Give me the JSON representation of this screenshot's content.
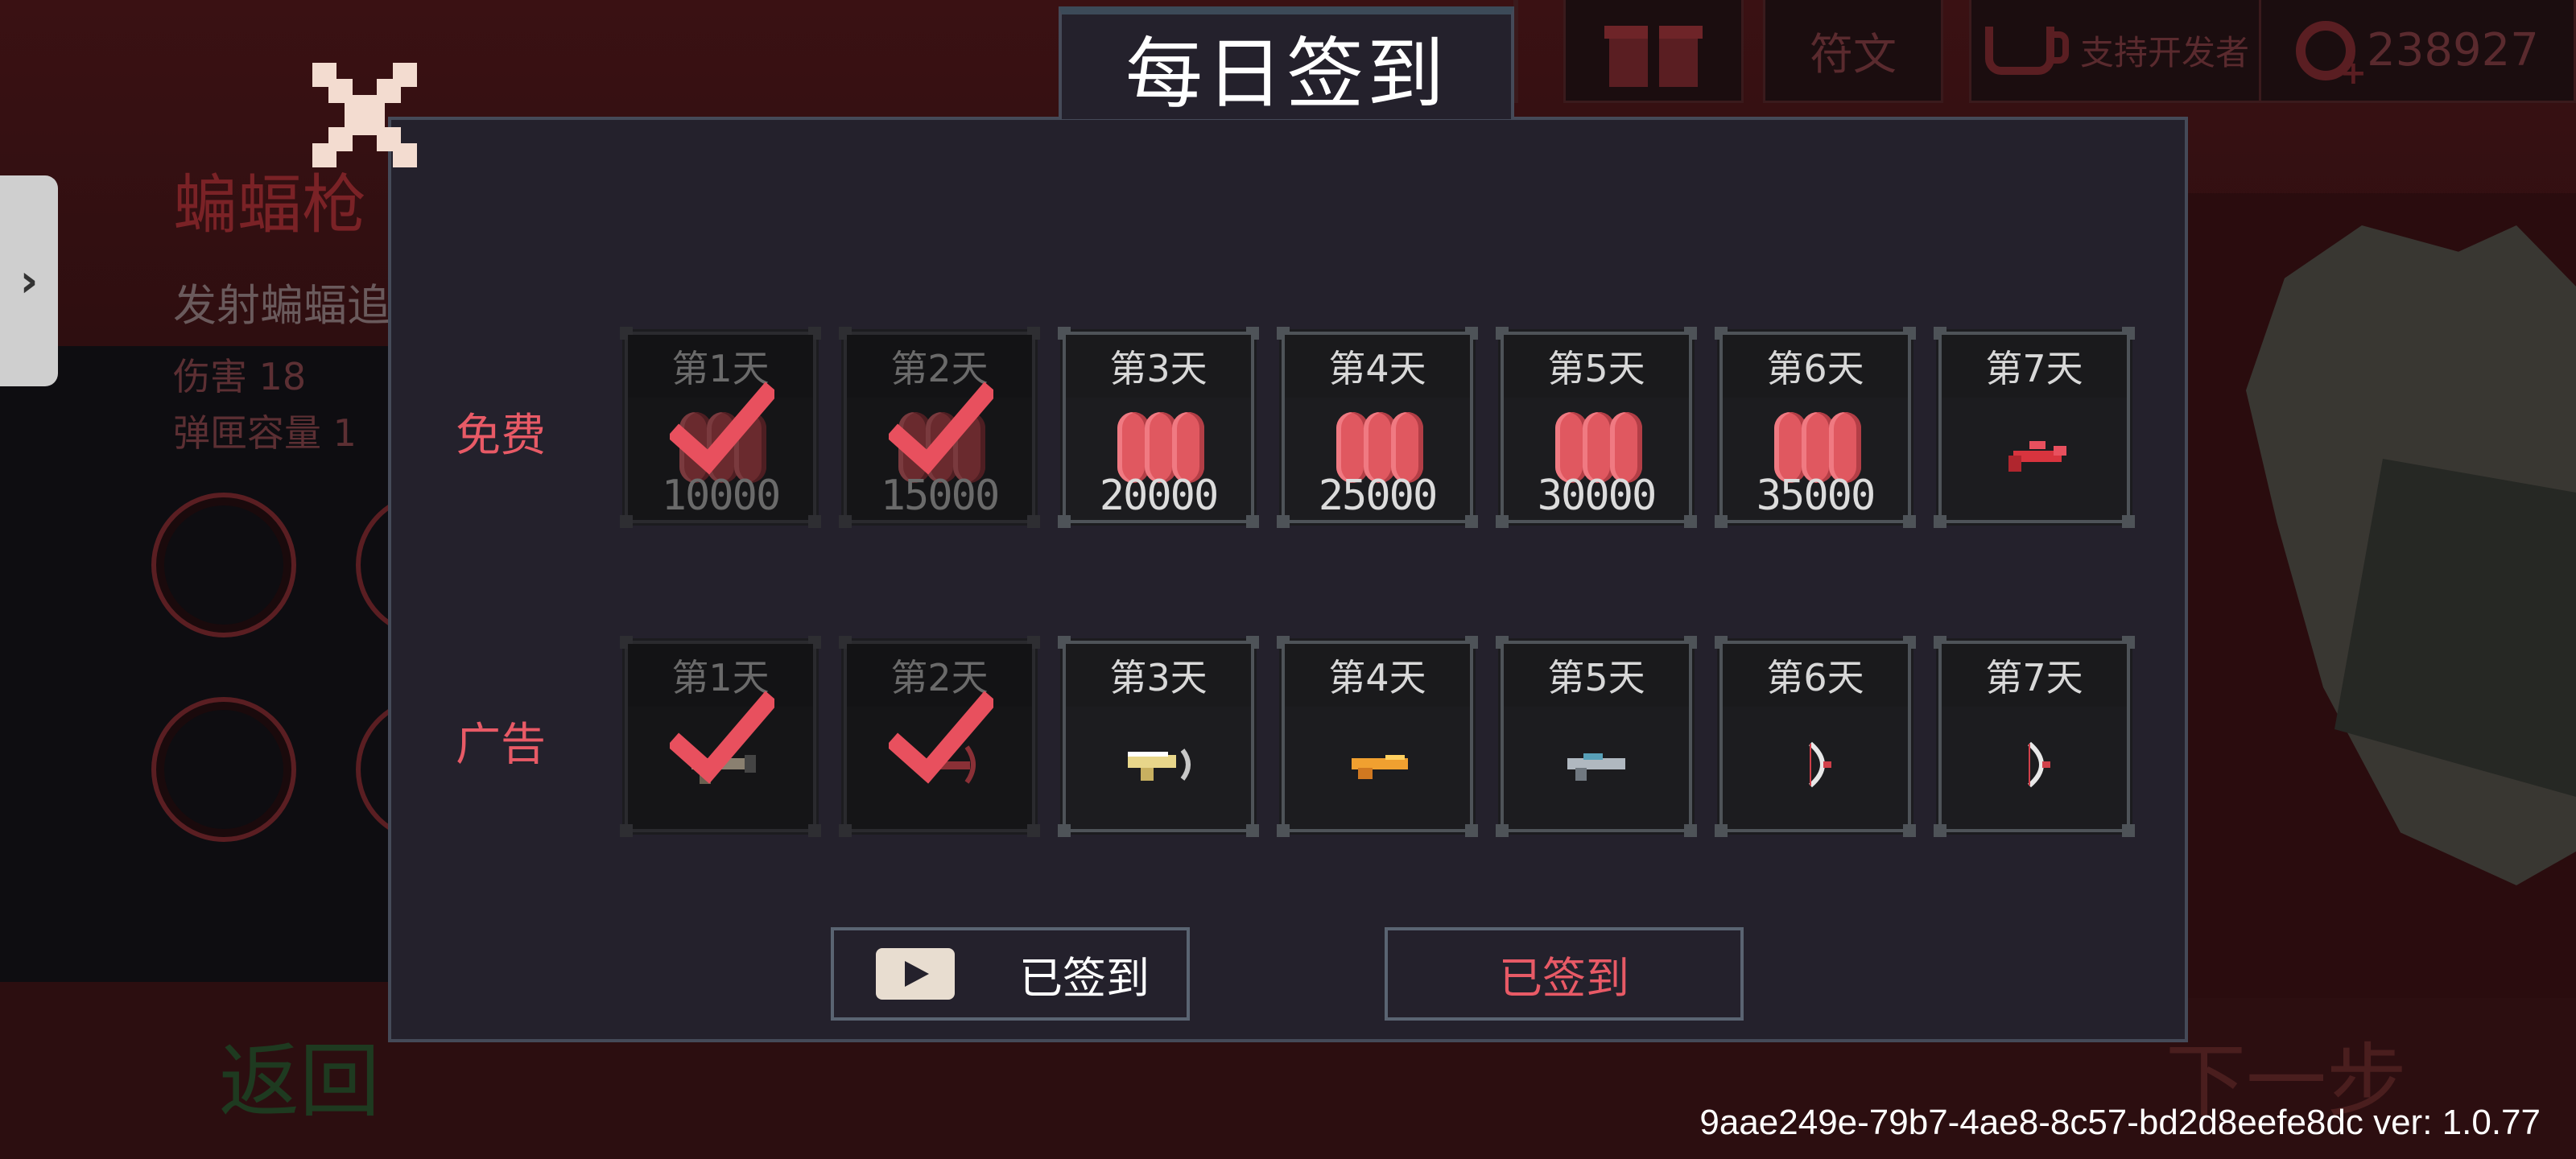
{
  "background": {
    "weapon_title": "蝙蝠枪",
    "weapon_desc": "发射蝙蝠追",
    "stats": [
      {
        "label": "伤害",
        "value": "18"
      },
      {
        "label": "弹匣容量",
        "value": "1"
      }
    ],
    "back_label": "返回",
    "next_label": "下一步"
  },
  "topbar": {
    "runes_label": "符文",
    "support_label": "支持开发者",
    "currency_value": "238927",
    "icons": [
      "gift-icon",
      "coffee-icon",
      "currency-icon"
    ]
  },
  "dialog": {
    "title": "每日签到",
    "free_row_label": "免费",
    "ad_row_label": "广告",
    "free_rewards": [
      {
        "day": "第1天",
        "amount": "10000",
        "claimed": true,
        "icon": "coin-stack-icon"
      },
      {
        "day": "第2天",
        "amount": "15000",
        "claimed": true,
        "icon": "coin-stack-icon"
      },
      {
        "day": "第3天",
        "amount": "20000",
        "claimed": false,
        "icon": "coin-stack-icon"
      },
      {
        "day": "第4天",
        "amount": "25000",
        "claimed": false,
        "icon": "coin-stack-icon"
      },
      {
        "day": "第5天",
        "amount": "30000",
        "claimed": false,
        "icon": "coin-stack-icon"
      },
      {
        "day": "第6天",
        "amount": "35000",
        "claimed": false,
        "icon": "coin-stack-icon"
      },
      {
        "day": "第7天",
        "amount": "",
        "claimed": false,
        "icon": "red-weapon-icon"
      }
    ],
    "ad_rewards": [
      {
        "day": "第1天",
        "claimed": true,
        "icon": "gun-icon"
      },
      {
        "day": "第2天",
        "claimed": true,
        "icon": "crossbow-icon"
      },
      {
        "day": "第3天",
        "claimed": false,
        "icon": "gold-gun-icon"
      },
      {
        "day": "第4天",
        "claimed": false,
        "icon": "orange-pistol-icon"
      },
      {
        "day": "第5天",
        "claimed": false,
        "icon": "silver-gun-icon"
      },
      {
        "day": "第6天",
        "claimed": false,
        "icon": "bow-icon"
      },
      {
        "day": "第7天",
        "claimed": false,
        "icon": "bow-icon"
      }
    ],
    "ad_button_label": "已签到",
    "free_button_label": "已签到"
  },
  "footer": {
    "build_info": "9aae249e-79b7-4ae8-8c57-bd2d8eefe8dc ver: 1.0.77"
  },
  "colors": {
    "accent_red": "#e85a66",
    "dialog_bg": "#24212c",
    "card_border": "#4e5358"
  }
}
